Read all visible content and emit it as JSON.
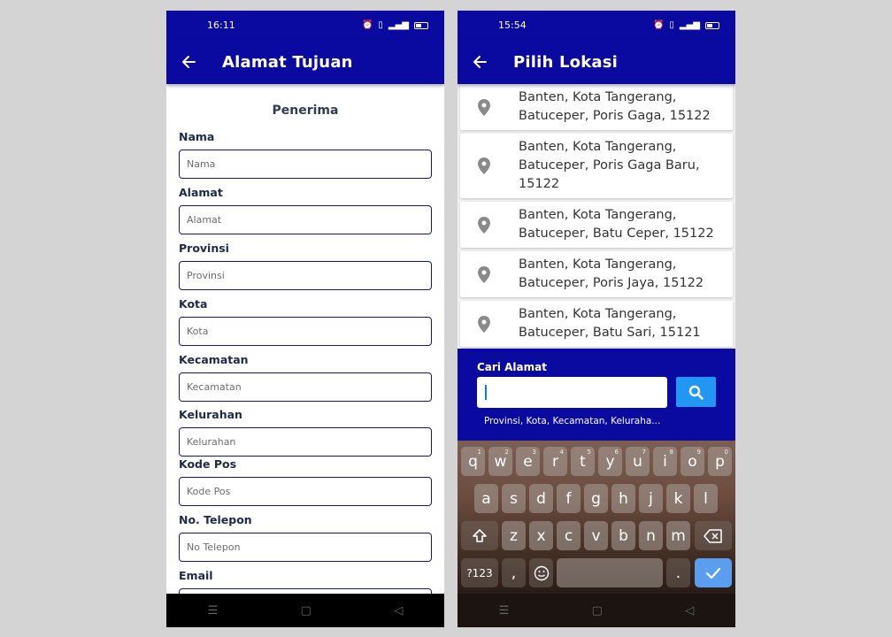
{
  "left": {
    "status_time": "16:11",
    "title": "Alamat Tujuan",
    "section_title": "Penerima",
    "fields": [
      {
        "label": "Nama",
        "placeholder": "Nama"
      },
      {
        "label": "Alamat",
        "placeholder": "Alamat"
      },
      {
        "label": "Provinsi",
        "placeholder": "Provinsi"
      },
      {
        "label": "Kota",
        "placeholder": "Kota"
      },
      {
        "label": "Kecamatan",
        "placeholder": "Kecamatan"
      },
      {
        "label": "Kelurahan",
        "placeholder": "Kelurahan"
      },
      {
        "label": "Kode Pos",
        "placeholder": "Kode Pos"
      },
      {
        "label": "No. Telepon",
        "placeholder": "No Telepon"
      },
      {
        "label": "Email",
        "placeholder": ""
      }
    ]
  },
  "right": {
    "status_time": "15:54",
    "title": "Pilih Lokasi",
    "locations": [
      "Banten, Kota Tangerang, Batuceper, Poris Gaga, 15122",
      "Banten, Kota Tangerang, Batuceper, Poris Gaga Baru, 15122",
      "Banten, Kota Tangerang, Batuceper, Batu Ceper, 15122",
      "Banten, Kota Tangerang, Batuceper, Poris Jaya, 15122",
      "Banten, Kota Tangerang, Batuceper, Batu Sari, 15121"
    ],
    "search": {
      "label": "Cari Alamat",
      "value": "",
      "hint": "Provinsi, Kota, Kecamatan, Keluraha..."
    },
    "keyboard": {
      "row1": [
        {
          "key": "q",
          "num": "1"
        },
        {
          "key": "w",
          "num": "2"
        },
        {
          "key": "e",
          "num": "3"
        },
        {
          "key": "r",
          "num": "4"
        },
        {
          "key": "t",
          "num": "5"
        },
        {
          "key": "y",
          "num": "6"
        },
        {
          "key": "u",
          "num": "7"
        },
        {
          "key": "i",
          "num": "8"
        },
        {
          "key": "o",
          "num": "9"
        },
        {
          "key": "p",
          "num": "0"
        }
      ],
      "row2": [
        "a",
        "s",
        "d",
        "f",
        "g",
        "h",
        "j",
        "k",
        "l"
      ],
      "row3": [
        "z",
        "x",
        "c",
        "v",
        "b",
        "n",
        "m"
      ],
      "symbols_label": "?123",
      "comma": ",",
      "period": "."
    }
  },
  "colors": {
    "primary": "#0a0aa0",
    "accent": "#2196f3",
    "field_border": "#14148a"
  },
  "icons": {
    "back": "arrow-left-icon",
    "pin": "location-pin-icon",
    "search": "search-icon",
    "shift": "shift-icon",
    "backspace": "backspace-icon",
    "emoji": "emoji-icon",
    "enter": "check-icon"
  }
}
